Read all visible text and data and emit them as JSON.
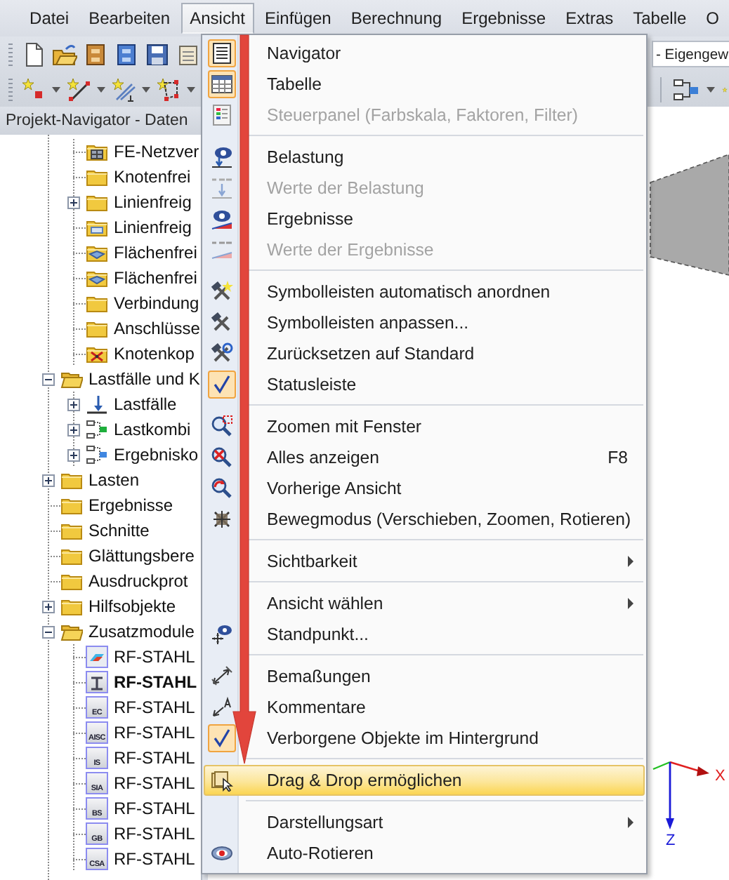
{
  "menu_bar": [
    {
      "label": "Datei",
      "selected": false
    },
    {
      "label": "Bearbeiten",
      "selected": false
    },
    {
      "label": "Ansicht",
      "selected": true
    },
    {
      "label": "Einfügen",
      "selected": false
    },
    {
      "label": "Berechnung",
      "selected": false
    },
    {
      "label": "Ergebnisse",
      "selected": false
    },
    {
      "label": "Extras",
      "selected": false
    },
    {
      "label": "Tabelle",
      "selected": false
    },
    {
      "label": "O",
      "selected": false
    }
  ],
  "toolbar": {
    "load_case_field": {
      "value": "- Eigengew"
    }
  },
  "navigator": {
    "title": "Projekt-Navigator - Daten",
    "tree": [
      {
        "kind": "continuation",
        "children": [
          {
            "label": "FE-Netzver",
            "kind": "mesh"
          },
          {
            "label": "Knotenfrei",
            "kind": "folder"
          },
          {
            "label": "Linienfreig",
            "kind": "folder",
            "expanded": false
          },
          {
            "label": "Linienfreig",
            "kind": "folder-line"
          },
          {
            "label": "Flächenfrei",
            "kind": "folder-surface"
          },
          {
            "label": "Flächenfrei",
            "kind": "folder-surface"
          },
          {
            "label": "Verbindung",
            "kind": "folder"
          },
          {
            "label": "Anschlüsse",
            "kind": "folder"
          },
          {
            "label": "Knotenkop",
            "kind": "coupling"
          }
        ]
      },
      {
        "label": "Lastfälle und K",
        "kind": "folder-open",
        "expanded": true,
        "children": [
          {
            "label": "Lastfälle",
            "kind": "load",
            "expanded": false
          },
          {
            "label": "Lastkombi",
            "kind": "combination-green",
            "expanded": false
          },
          {
            "label": "Ergebnisko",
            "kind": "combination-blue",
            "expanded": false
          }
        ]
      },
      {
        "label": "Lasten",
        "kind": "folder",
        "expanded": false
      },
      {
        "label": "Ergebnisse",
        "kind": "folder"
      },
      {
        "label": "Schnitte",
        "kind": "folder"
      },
      {
        "label": "Glättungsbere",
        "kind": "folder"
      },
      {
        "label": "Ausdruckprot",
        "kind": "folder"
      },
      {
        "label": "Hilfsobjekte",
        "kind": "folder",
        "expanded": false
      },
      {
        "label": "Zusatzmodule",
        "kind": "folder-open",
        "expanded": true,
        "children": [
          {
            "label": "RF-STAHL",
            "kind": "module-surface",
            "active": false
          },
          {
            "label": "RF-STAHL",
            "kind": "module",
            "active": true
          },
          {
            "label": "RF-STAHL",
            "kind": "module",
            "icon_text": "EC",
            "active": false
          },
          {
            "label": "RF-STAHL",
            "kind": "module",
            "icon_text": "AISC",
            "active": false
          },
          {
            "label": "RF-STAHL",
            "kind": "module",
            "icon_text": "IS",
            "active": false
          },
          {
            "label": "RF-STAHL",
            "kind": "module",
            "icon_text": "SIA",
            "active": false
          },
          {
            "label": "RF-STAHL",
            "kind": "module",
            "icon_text": "BS",
            "active": false
          },
          {
            "label": "RF-STAHL",
            "kind": "module",
            "icon_text": "GB",
            "active": false
          },
          {
            "label": "RF-STAHL",
            "kind": "module",
            "icon_text": "CSA",
            "active": false
          }
        ]
      }
    ]
  },
  "view": {
    "axes": {
      "x_label": "X",
      "z_label": "Z"
    }
  },
  "menu": {
    "entries": [
      {
        "kind": "navigator",
        "label": "Navigator",
        "checked": true,
        "disabled": false,
        "selected": false,
        "submenu": false
      },
      {
        "kind": "table",
        "label": "Tabelle",
        "checked": true,
        "disabled": false,
        "selected": false,
        "submenu": false
      },
      {
        "kind": "panel",
        "label": "Steuerpanel (Farbskala, Faktoren, Filter)",
        "checked": false,
        "disabled": true,
        "selected": false,
        "submenu": false
      },
      {
        "kind": "separator"
      },
      {
        "kind": "load-eye",
        "label": "Belastung",
        "checked": false,
        "disabled": false,
        "selected": false,
        "submenu": false
      },
      {
        "kind": "load-values",
        "label": "Werte der Belastung",
        "checked": false,
        "disabled": true,
        "selected": false,
        "submenu": false
      },
      {
        "kind": "result-eye",
        "label": "Ergebnisse",
        "checked": false,
        "disabled": false,
        "selected": false,
        "submenu": false
      },
      {
        "kind": "result-values",
        "label": "Werte der Ergebnisse",
        "checked": false,
        "disabled": true,
        "selected": false,
        "submenu": false
      },
      {
        "kind": "separator"
      },
      {
        "kind": "tools-star",
        "label": "Symbolleisten automatisch anordnen",
        "checked": false,
        "disabled": false,
        "selected": false,
        "submenu": false
      },
      {
        "kind": "tools",
        "label": "Symbolleisten anpassen...",
        "checked": false,
        "disabled": false,
        "selected": false,
        "submenu": false
      },
      {
        "kind": "tools-reset",
        "label": "Zurücksetzen auf Standard",
        "checked": false,
        "disabled": false,
        "selected": false,
        "submenu": false
      },
      {
        "kind": "plain",
        "label": "Statusleiste",
        "checked": true,
        "disabled": false,
        "selected": false,
        "submenu": false
      },
      {
        "kind": "separator"
      },
      {
        "kind": "zoom-window",
        "label": "Zoomen mit Fenster",
        "checked": false,
        "disabled": false,
        "selected": false,
        "submenu": false
      },
      {
        "kind": "zoom-all",
        "label": "Alles anzeigen",
        "shortcut": "F8",
        "checked": false,
        "disabled": false,
        "selected": false,
        "submenu": false
      },
      {
        "kind": "zoom-previous",
        "label": "Vorherige Ansicht",
        "checked": false,
        "disabled": false,
        "selected": false,
        "submenu": false
      },
      {
        "kind": "move",
        "label": "Bewegmodus (Verschieben, Zoomen, Rotieren)",
        "checked": false,
        "disabled": false,
        "selected": false,
        "submenu": false
      },
      {
        "kind": "separator"
      },
      {
        "kind": "plain",
        "label": "Sichtbarkeit",
        "checked": false,
        "disabled": false,
        "selected": false,
        "submenu": true
      },
      {
        "kind": "separator"
      },
      {
        "kind": "plain",
        "label": "Ansicht wählen",
        "checked": false,
        "disabled": false,
        "selected": false,
        "submenu": true
      },
      {
        "kind": "viewpoint",
        "label": "Standpunkt...",
        "checked": false,
        "disabled": false,
        "selected": false,
        "submenu": false
      },
      {
        "kind": "separator"
      },
      {
        "kind": "dimension",
        "label": "Bemaßungen",
        "checked": false,
        "disabled": false,
        "selected": false,
        "submenu": false
      },
      {
        "kind": "comment",
        "label": "Kommentare",
        "checked": false,
        "disabled": false,
        "selected": false,
        "submenu": false
      },
      {
        "kind": "plain",
        "label": "Verborgene Objekte im Hintergrund",
        "checked": true,
        "disabled": false,
        "selected": false,
        "submenu": false
      },
      {
        "kind": "separator"
      },
      {
        "kind": "drag-drop",
        "label": "Drag & Drop ermöglichen",
        "checked": false,
        "disabled": false,
        "selected": true,
        "submenu": false
      },
      {
        "kind": "separator"
      },
      {
        "kind": "plain",
        "label": "Darstellungsart",
        "checked": false,
        "disabled": false,
        "selected": false,
        "submenu": true
      },
      {
        "kind": "rotate",
        "label": "Auto-Rotieren",
        "checked": false,
        "disabled": false,
        "selected": false,
        "submenu": false
      }
    ]
  }
}
